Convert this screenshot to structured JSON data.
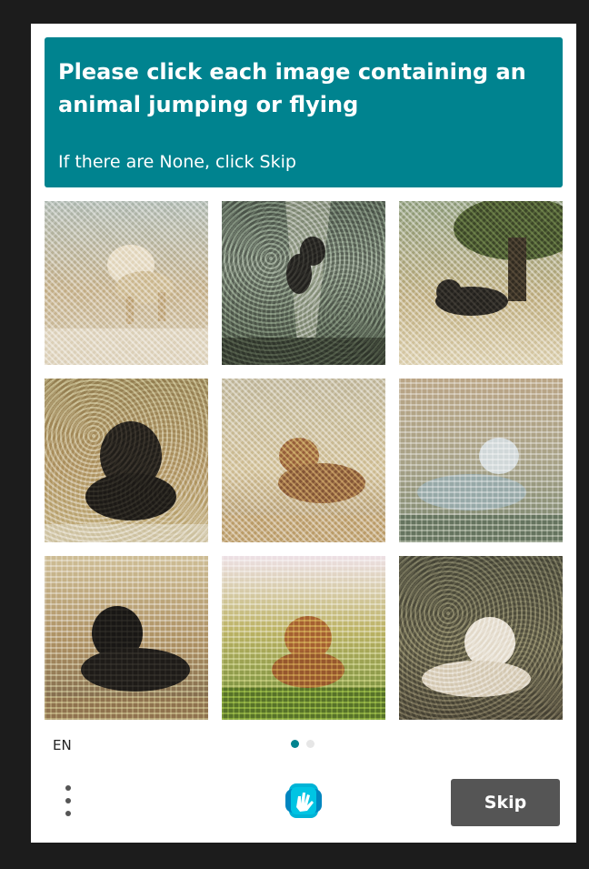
{
  "challenge": {
    "prompt": "Please click each image containing an animal jumping or flying",
    "subprompt": "If there are None, click Skip"
  },
  "grid": {
    "tiles": [
      {
        "name": "tile-1",
        "subject": "lion-jumping"
      },
      {
        "name": "tile-2",
        "subject": "animal-leaping-in-forest"
      },
      {
        "name": "tile-3",
        "subject": "lion-under-tree"
      },
      {
        "name": "tile-4",
        "subject": "lion-sitting"
      },
      {
        "name": "tile-5",
        "subject": "lion-lying"
      },
      {
        "name": "tile-6",
        "subject": "white-lion-lying"
      },
      {
        "name": "tile-7",
        "subject": "dark-lion-lying"
      },
      {
        "name": "tile-8",
        "subject": "lion-in-grass"
      },
      {
        "name": "tile-9",
        "subject": "white-lion-resting"
      }
    ]
  },
  "footer": {
    "language": "EN",
    "page_count": 2,
    "current_page": 1,
    "skip_label": "Skip",
    "menu_icon": "more-vertical-icon",
    "logo_icon": "hcaptcha-logo-icon"
  },
  "colors": {
    "accent": "#00838f",
    "skip_bg": "#555555",
    "background": "#1c1c1c"
  }
}
